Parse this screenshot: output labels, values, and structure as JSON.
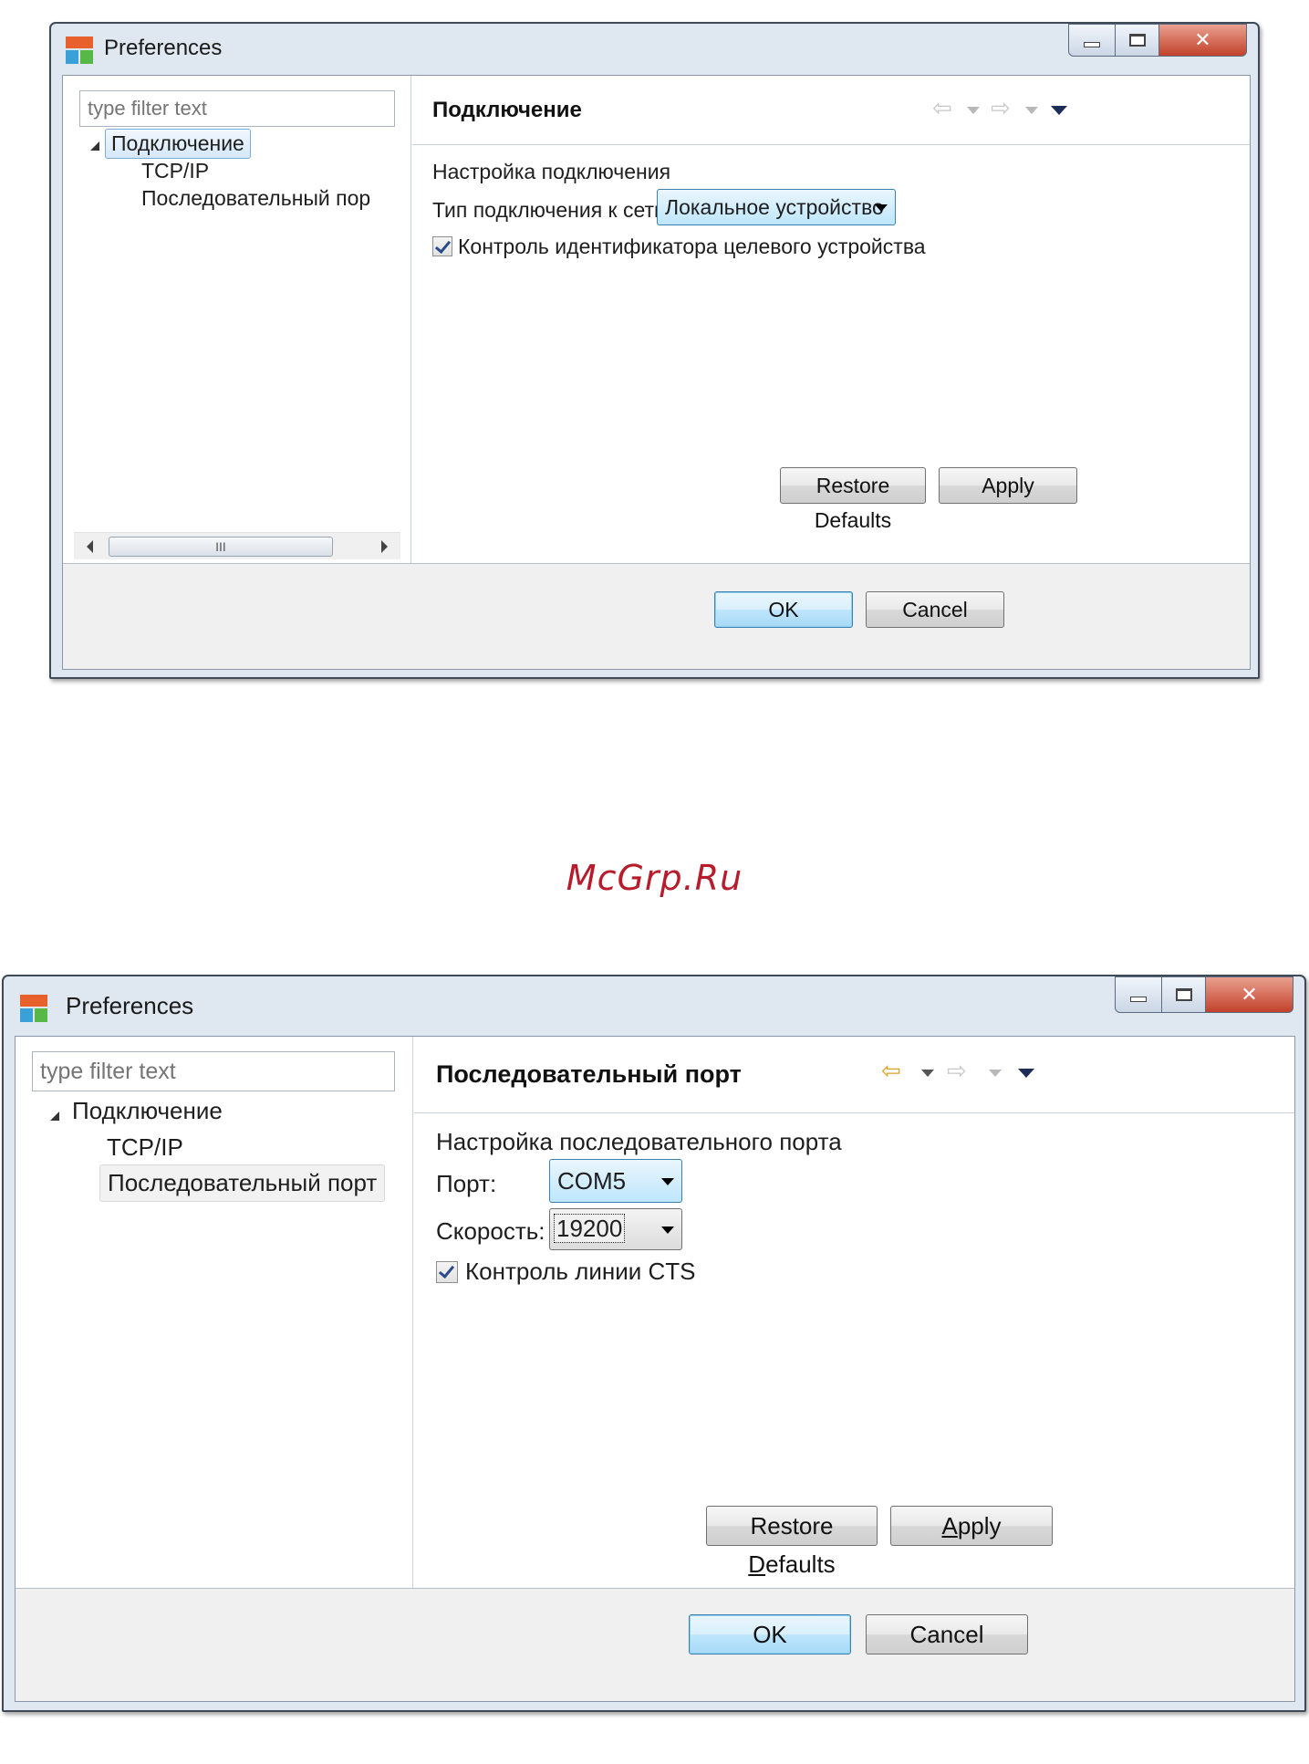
{
  "window1": {
    "title": "Preferences",
    "filter_placeholder": "type filter text",
    "tree": {
      "root": "Подключение",
      "child1": "TCP/IP",
      "child2": "Последовательный пор"
    },
    "scrollbar_grip": "III",
    "page_title": "Подключение",
    "section_label": "Настройка подключения",
    "network_type_label": "Тип подключения к сети",
    "network_type_value": "Локальное устройство",
    "checkbox_label": "Контроль идентификатора целевого устройства",
    "restore_defaults": "Restore Defaults",
    "apply": "Apply",
    "ok": "OK",
    "cancel": "Cancel"
  },
  "watermark": "McGrp.Ru",
  "window2": {
    "title": "Preferences",
    "filter_placeholder": "type filter text",
    "tree": {
      "root": "Подключение",
      "child1": "TCP/IP",
      "child2": "Последовательный порт"
    },
    "page_title": "Последовательный порт",
    "section_label": "Настройка последовательного порта",
    "port_label": "Порт:",
    "port_value": "COM5",
    "speed_label": "Скорость:",
    "speed_value": "19200",
    "checkbox_label": "Контроль линии CTS",
    "restore_defaults_pre": "Restore ",
    "restore_defaults_mn": "D",
    "restore_defaults_post": "efaults",
    "apply_mn": "A",
    "apply_post": "pply",
    "ok": "OK",
    "cancel": "Cancel"
  },
  "colors": {
    "window_frame": "#dfe7f1",
    "selection_border": "#7dacd9",
    "default_button": "#bee6fd",
    "close_button": "#c2412a",
    "nav_active": "#e0a125",
    "watermark": "#b71c2c"
  },
  "icons": {
    "app": "eclipse-app-icon",
    "back": "back-arrow-icon",
    "forward": "forward-arrow-icon",
    "menu": "view-menu-icon",
    "minimize": "minimize-icon",
    "maximize": "maximize-icon",
    "close": "close-icon"
  }
}
